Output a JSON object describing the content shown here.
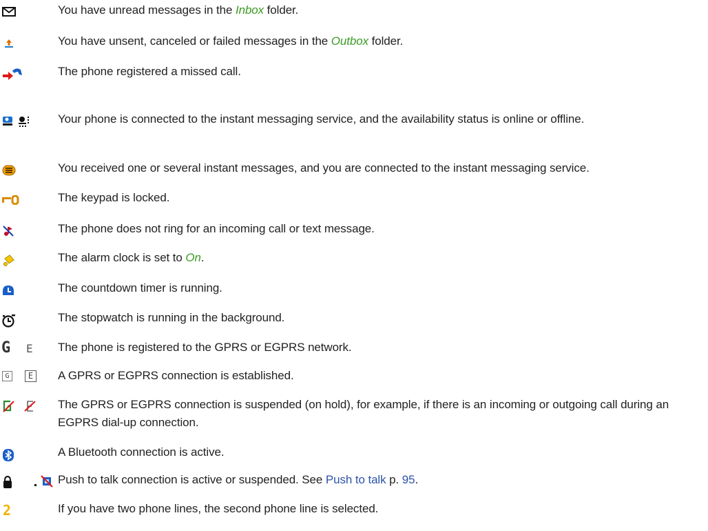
{
  "rows": [
    {
      "name": "unread-messages",
      "icon": "envelope-icon",
      "text_pre": "You have unread messages in the ",
      "em": "Inbox",
      "text_post": " folder."
    },
    {
      "name": "outbox-messages",
      "icon": "outbox-upload-icon",
      "text_pre": "You have unsent, canceled or failed messages in the ",
      "em": "Outbox",
      "text_post": " folder."
    },
    {
      "name": "missed-call",
      "icon": "missed-call-icon",
      "text": "The phone registered a missed call."
    },
    {
      "name": "im-connected",
      "icon": "instant-messaging-status-icon",
      "text": "Your phone is connected to the instant messaging service, and the availability status is online or offline."
    },
    {
      "name": "im-received",
      "icon": "instant-message-icon",
      "text": "You received one or several instant messages, and you are connected to the instant messaging service."
    },
    {
      "name": "keypad-locked",
      "icon": "key-icon",
      "text": "The keypad is locked."
    },
    {
      "name": "silent",
      "icon": "silent-note-icon",
      "text": "The phone does not ring for an incoming call or text message."
    },
    {
      "name": "alarm",
      "icon": "alarm-bell-icon",
      "text_pre": "The alarm clock is set to ",
      "em": "On",
      "text_post": "."
    },
    {
      "name": "countdown",
      "icon": "countdown-timer-icon",
      "text": "The countdown timer is running."
    },
    {
      "name": "stopwatch",
      "icon": "stopwatch-icon",
      "text": "The stopwatch is running in the background."
    },
    {
      "name": "gprs-registered",
      "icon": "gprs-registered-icon",
      "label_g": "G",
      "label_e": "E",
      "text": "The phone is registered to the GPRS or EGPRS network."
    },
    {
      "name": "gprs-established",
      "icon": "gprs-connection-icon",
      "label_g": "G",
      "label_e": "E",
      "text": "A GPRS or EGPRS connection is established."
    },
    {
      "name": "gprs-suspended",
      "icon": "gprs-suspended-icon",
      "text": "The GPRS or EGPRS connection is suspended (on hold), for example, if there is an incoming or outgoing call during an EGPRS dial-up connection."
    },
    {
      "name": "bluetooth",
      "icon": "bluetooth-icon",
      "text": "A Bluetooth connection is active."
    },
    {
      "name": "push-to-talk",
      "icon": "push-to-talk-icon",
      "text_pre": "Push to talk connection is active or suspended. See ",
      "link": "Push to talk",
      "text_post": " p. ",
      "page": "95",
      "text_end": "."
    },
    {
      "name": "second-line",
      "icon": "line-two-icon",
      "label": "2",
      "text": "If you have two phone lines, the second phone line is selected."
    }
  ],
  "colors": {
    "emphasis": "#3a9a24",
    "link": "#2d53a8",
    "text": "#222222"
  }
}
